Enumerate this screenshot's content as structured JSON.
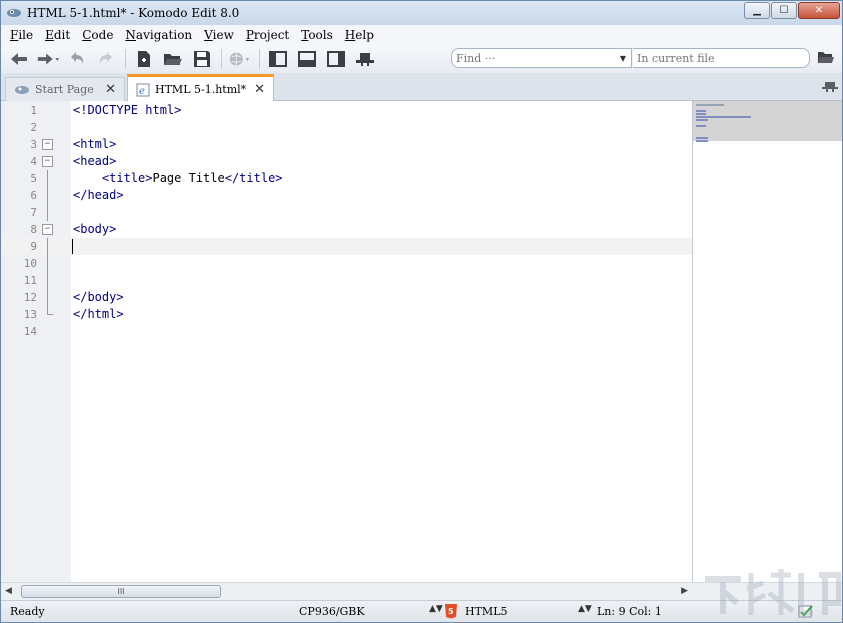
{
  "window": {
    "title": "HTML 5-1.html* - Komodo Edit 8.0",
    "controls": {
      "minimize": "▁",
      "maximize": "☐",
      "close": "✕"
    }
  },
  "menu": [
    {
      "label_u": "F",
      "label_rest": "ile"
    },
    {
      "label_u": "E",
      "label_rest": "dit"
    },
    {
      "label_u": "C",
      "label_rest": "ode"
    },
    {
      "label_u": "N",
      "label_rest": "avigation"
    },
    {
      "label_u": "V",
      "label_rest": "iew"
    },
    {
      "label_u": "P",
      "label_rest": "roject"
    },
    {
      "label_u": "T",
      "label_rest": "ools"
    },
    {
      "label_u": "H",
      "label_rest": "elp"
    }
  ],
  "toolbar": {
    "icons": [
      "back-arrow-icon",
      "forward-arrow-icon",
      "undo-icon",
      "redo-icon",
      "new-file-icon",
      "open-folder-icon",
      "save-icon",
      "browser-preview-icon",
      "left-pane-icon",
      "bottom-pane-icon",
      "right-pane-icon",
      "hat-icon"
    ],
    "find_placeholder": "Find ···",
    "scope_placeholder": "In current file"
  },
  "tabs": [
    {
      "label": "Start Page",
      "close": "✕",
      "active": false
    },
    {
      "label": "HTML 5-1.html*",
      "close": "✕",
      "active": true
    }
  ],
  "editor": {
    "lines": [
      {
        "n": "1",
        "code": "<!DOCTYPE html>"
      },
      {
        "n": "2",
        "code": ""
      },
      {
        "n": "3",
        "code": "<html>"
      },
      {
        "n": "4",
        "code": "<head>"
      },
      {
        "n": "5",
        "code": "    <title>Page Title</title>"
      },
      {
        "n": "6",
        "code": "</head>"
      },
      {
        "n": "7",
        "code": ""
      },
      {
        "n": "8",
        "code": "<body>"
      },
      {
        "n": "9",
        "code": ""
      },
      {
        "n": "10",
        "code": ""
      },
      {
        "n": "11",
        "code": ""
      },
      {
        "n": "12",
        "code": "</body>"
      },
      {
        "n": "13",
        "code": "</html>"
      },
      {
        "n": "14",
        "code": ""
      }
    ],
    "current_line": 9
  },
  "scrollbar": {
    "left": "◀",
    "right": "▶",
    "thumb": "III"
  },
  "status": {
    "state": "Ready",
    "encoding": "CP936/GBK",
    "language": "HTML5",
    "position": "Ln: 9 Col: 1",
    "spin": "▲▼"
  },
  "colors": {
    "accent_tab": "#f39a2b",
    "tag": "#00007f",
    "html5_badge": "#e44d26"
  }
}
